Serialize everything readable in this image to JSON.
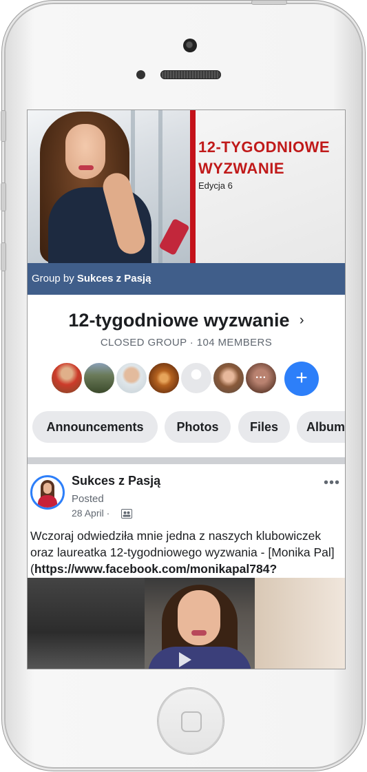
{
  "cover": {
    "title_line1": "12-TYGODNIOWE",
    "title_line2": "WYZWANIE",
    "subtitle": "Edycja 6",
    "group_by_prefix": "Group by",
    "group_by_name": "Sukces z Pasją"
  },
  "group": {
    "title": "12-tygodniowe wyzwanie",
    "meta": "CLOSED GROUP · 104 MEMBERS",
    "chevron": "›",
    "add_member_icon": "+",
    "more_members_icon": "···"
  },
  "tabs": [
    {
      "label": "Announcements"
    },
    {
      "label": "Photos"
    },
    {
      "label": "Files"
    },
    {
      "label": "Albums"
    }
  ],
  "post": {
    "author": "Sukces z Pasją",
    "posted_label": "Posted",
    "date": "28 April ·",
    "more_icon": "•••",
    "text_plain": "Wczoraj odwiedziła mnie jedna z naszych klubowiczek oraz laureatka 12-tygodniowego wyzwania - [Monika Pal](",
    "text_bold": "https://www.facebook.com/monikapal784?"
  },
  "colors": {
    "accent": "#2d7ff9",
    "cover_red": "#c4121a",
    "group_bar": "#405e8a"
  }
}
